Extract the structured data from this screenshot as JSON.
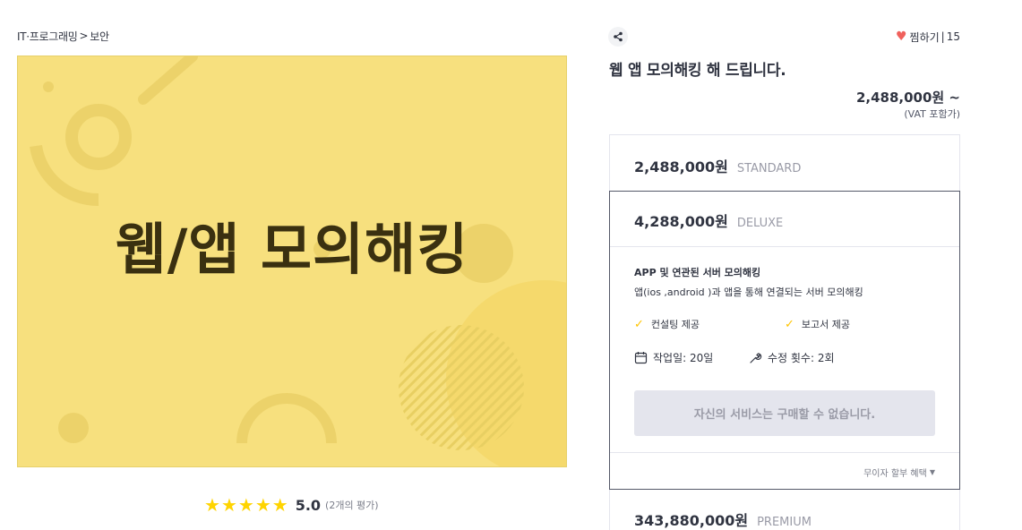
{
  "breadcrumb": {
    "category": "IT·프로그래밍",
    "separator": ">",
    "subcategory": "보안"
  },
  "hero": {
    "title": "웹/앱 모의해킹"
  },
  "rating": {
    "score": "5.0",
    "count": "(2개의 평가)",
    "stars": 5
  },
  "favorite": {
    "label": "찜하기",
    "separator": "|",
    "count": "15"
  },
  "service": {
    "title": "웹 앱 모의해킹 해 드립니다.",
    "price_from": "2,488,000원 ~",
    "vat": "(VAT 포함가)"
  },
  "packages": {
    "standard": {
      "price": "2,488,000원",
      "name": "STANDARD"
    },
    "deluxe": {
      "price": "4,288,000원",
      "name": "DELUXE",
      "desc_title": "APP 및 연관된 서버 모의해킹",
      "desc": "앱(ios ,android )과 앱을 통해 연결되는 서버 모의해킹",
      "feature1": "컨설팅 제공",
      "feature2": "보고서 제공",
      "work_days": "작업일: 20일",
      "revisions": "수정 횟수: 2회",
      "buy_label": "자신의 서비스는 구매할 수 없습니다.",
      "refund_label": "무이자 할부 혜택"
    },
    "premium": {
      "price": "343,880,000원",
      "name": "PREMIUM"
    }
  },
  "colors": {
    "hero_bg": "#f7e07e",
    "star": "#ffd400",
    "heart": "#f0615c",
    "check": "#ffc400"
  }
}
